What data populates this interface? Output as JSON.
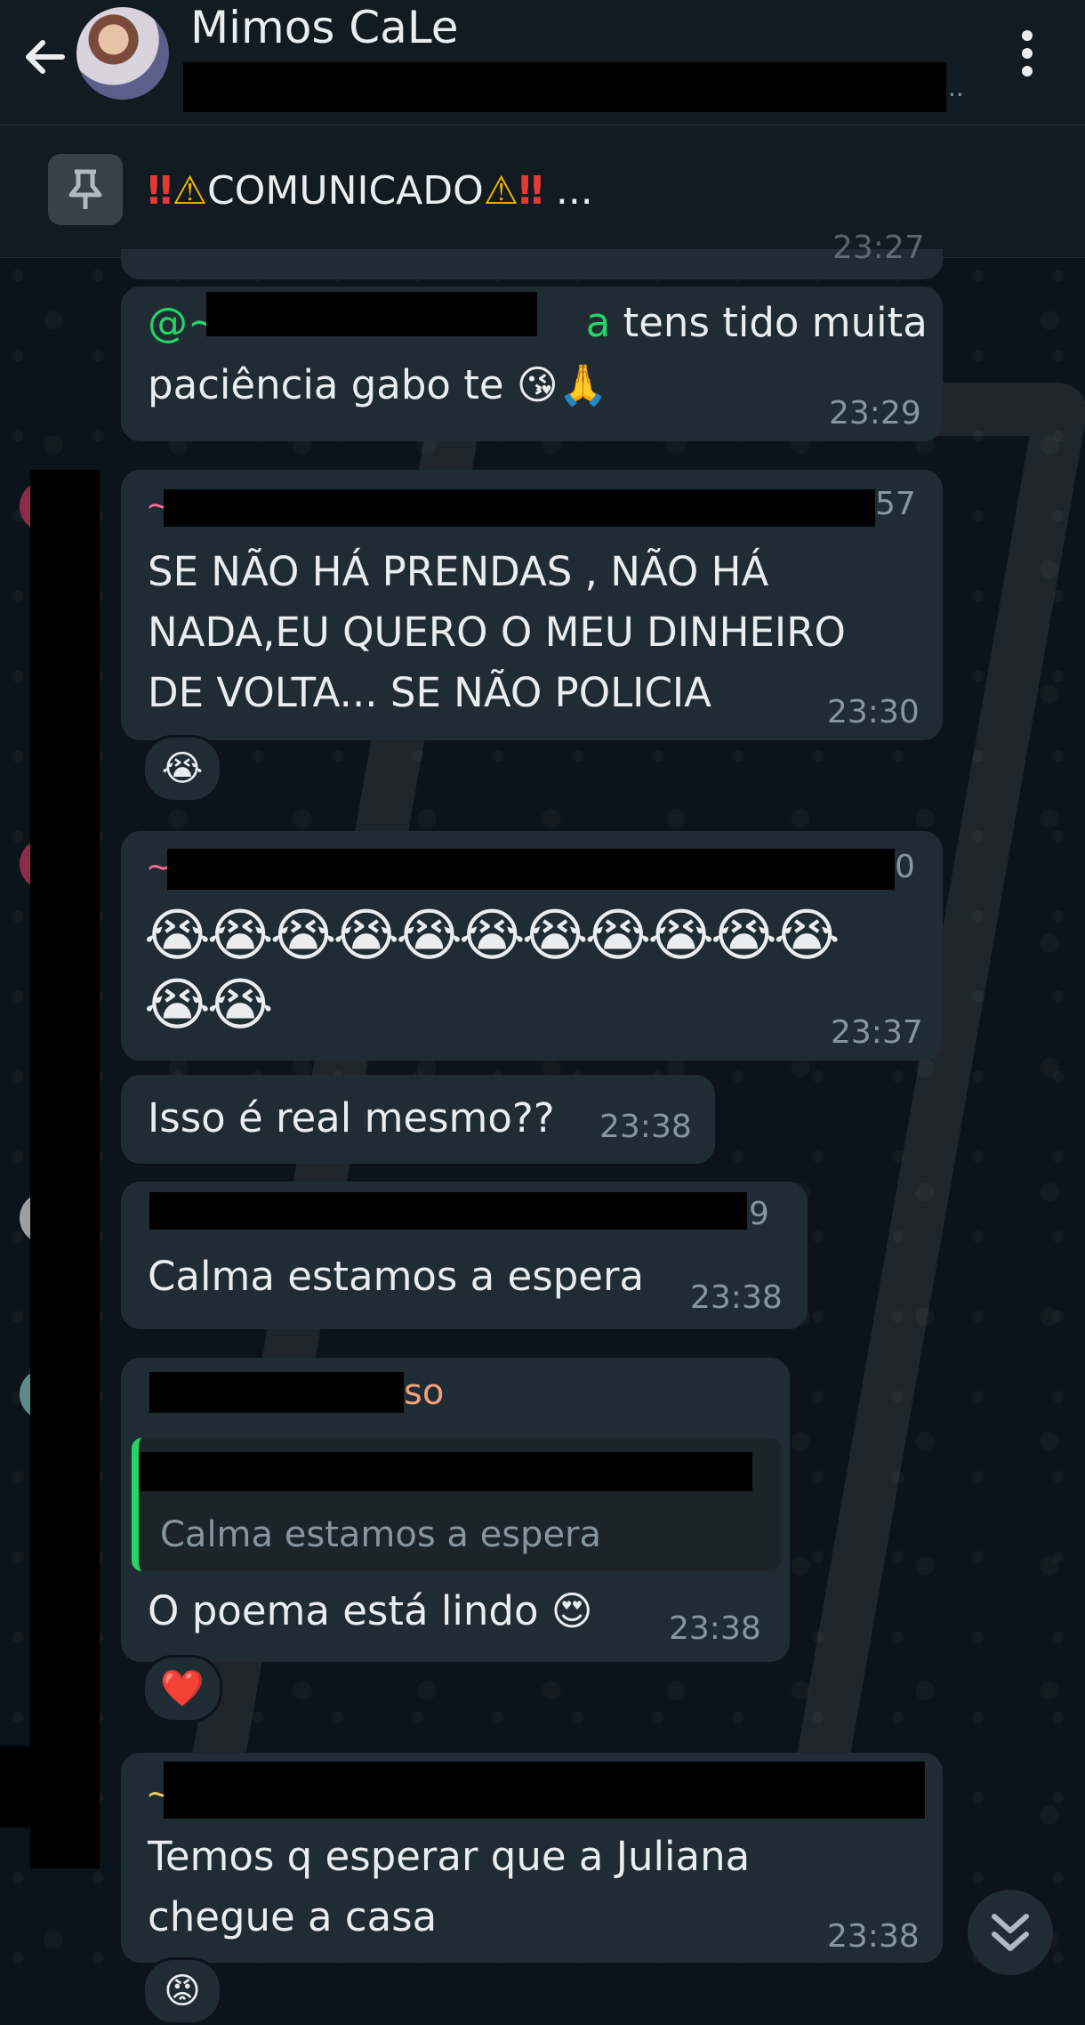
{
  "header": {
    "title": "Mimos CaLe",
    "subtitle_suffix": ".."
  },
  "pinned": {
    "bang1": "‼",
    "warn1": "⚠",
    "text": "COMUNICADO",
    "warn2": "⚠",
    "bang2": "‼",
    "ellipsis": " ..."
  },
  "messages": {
    "m0": {
      "time_partial": "23:27"
    },
    "m1": {
      "mention_prefix": "@~",
      "mention_tail": "a",
      "line1": " tens tido muita",
      "line2": "paciência gabo te 😘🙏",
      "time": "23:29"
    },
    "m2": {
      "tilde": "~",
      "meta_tail": "57",
      "line1": "SE NÃO HÁ PRENDAS , NÃO HÁ",
      "line2": "NADA,EU QUERO O MEU DINHEIRO",
      "line3": "DE VOLTA... SE NÃO POLICIA",
      "time": "23:30",
      "reaction": "😭"
    },
    "m3": {
      "tilde": "~",
      "meta_tail": "0",
      "emojis1": "😭😭😭😭😭😭😭😭😭😭😭",
      "emojis2": "😭😭",
      "time": "23:37"
    },
    "m4": {
      "text": "Isso é real mesmo??",
      "time": "23:38"
    },
    "m5": {
      "meta_tail": "9",
      "text": "Calma estamos a espera",
      "time": "23:38"
    },
    "m6": {
      "sender_tail": "so",
      "quote_text": "Calma estamos a espera",
      "text": "O poema está lindo 😍",
      "time": "23:38",
      "reaction": "❤️"
    },
    "m7": {
      "tilde": "~",
      "line1": "Temos q esperar que a Juliana",
      "line2": "chegue a casa",
      "time": "23:38",
      "reaction": "😡"
    }
  },
  "colors": {
    "background": "#0b141a",
    "bubble": "#202c33",
    "header": "#111b21",
    "mention": "#25d366",
    "meta": "#8696a0"
  },
  "icons": {
    "back": "arrow-left-icon",
    "menu": "more-vertical-icon",
    "pin": "pin-icon",
    "scroll": "chevrons-down-icon"
  }
}
